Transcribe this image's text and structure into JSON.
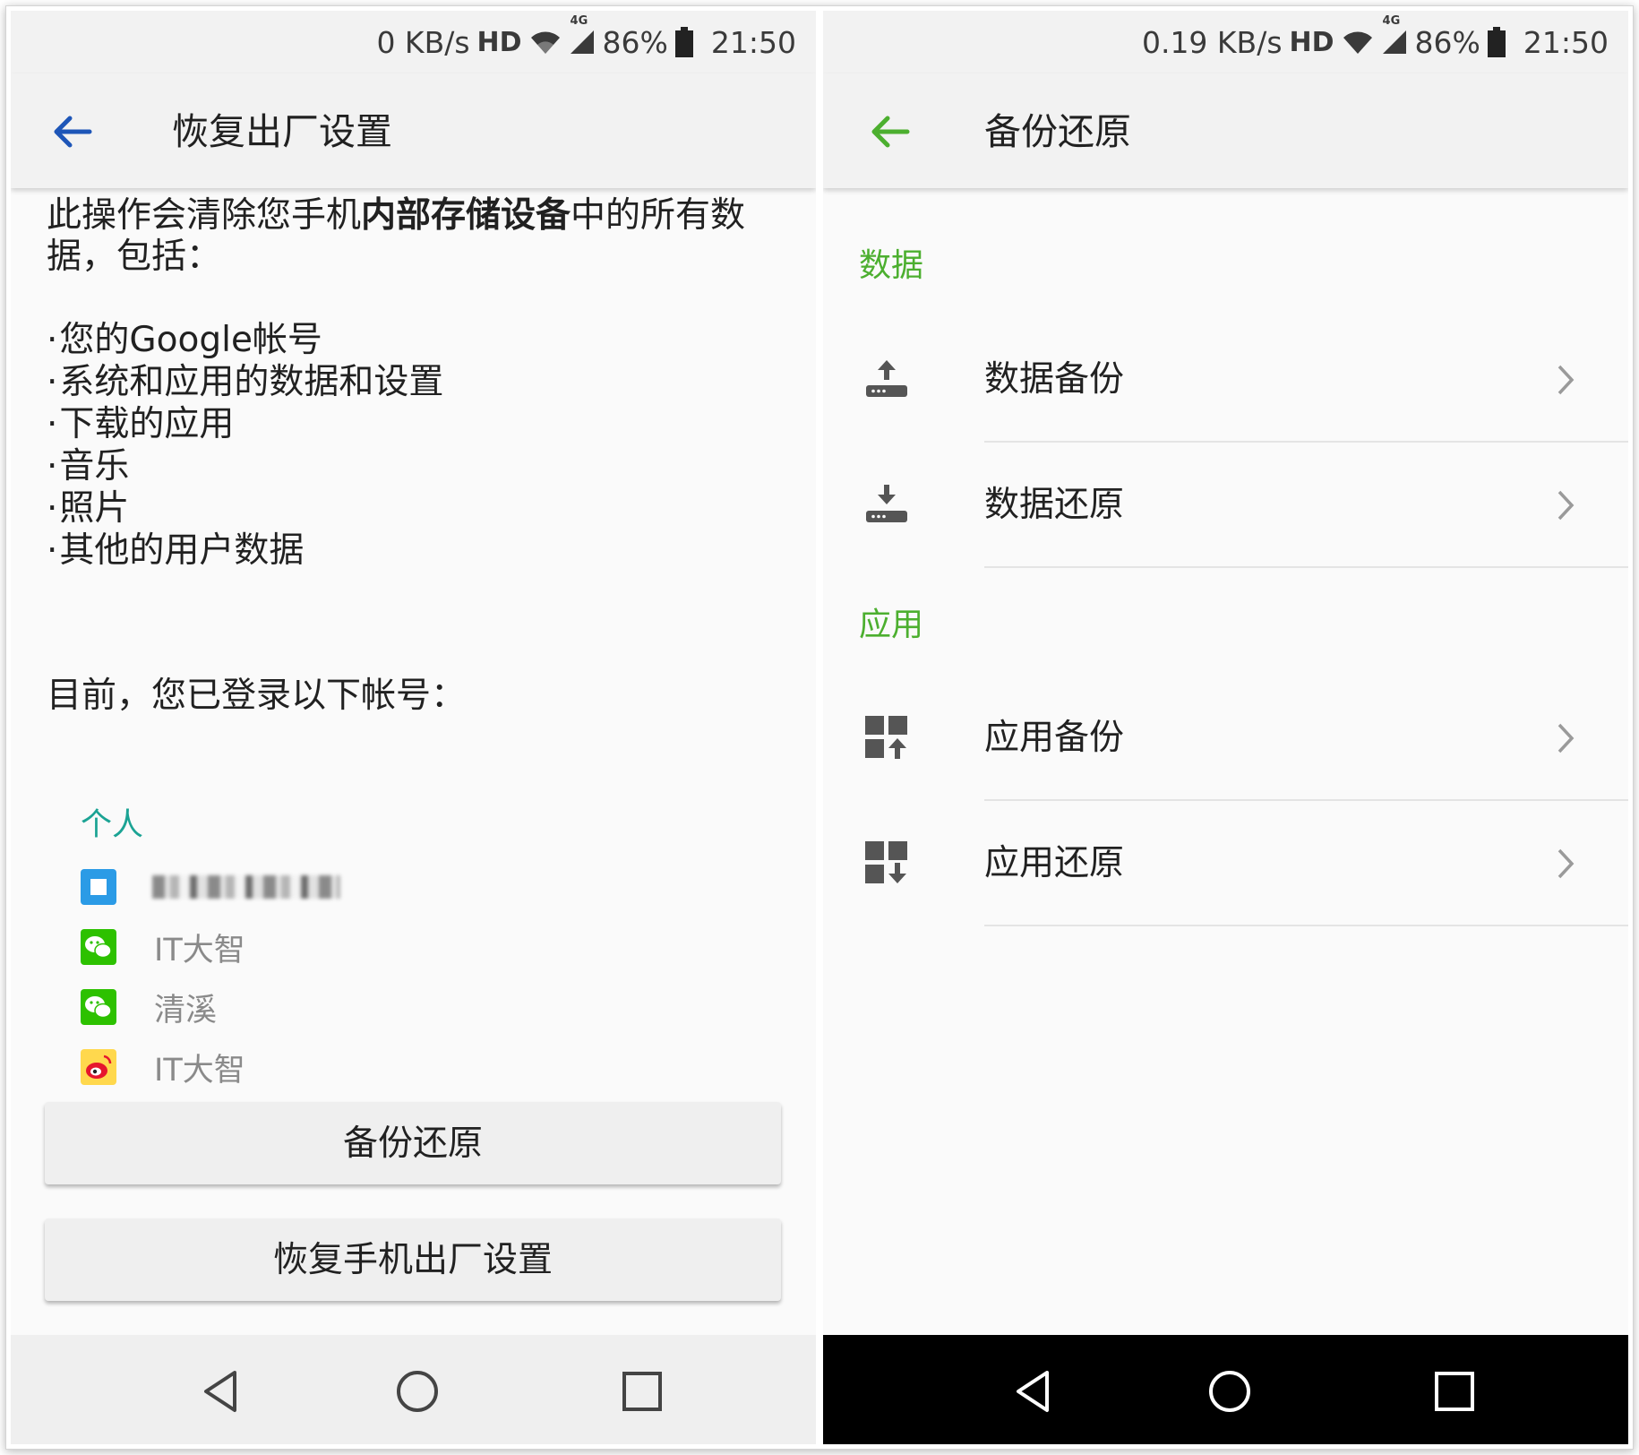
{
  "left": {
    "status": {
      "speed": "0 KB/s",
      "hd": "HD",
      "network": "4G",
      "battery": "86%",
      "time": "21:50"
    },
    "title": "恢复出厂设置",
    "intro_pre": "此操作会清除您手机",
    "intro_bold": "内部存储设备",
    "intro_post": "中的所有数据，包括：",
    "bullets": [
      "您的Google帐号",
      "系统和应用的数据和设置",
      "下载的应用",
      "音乐",
      "照片",
      "其他的用户数据"
    ],
    "logged_in": "目前，您已登录以下帐号：",
    "section_personal": "个人",
    "accounts": [
      {
        "icon": "square-app-icon",
        "name": ""
      },
      {
        "icon": "wechat-icon",
        "name": "IT大智"
      },
      {
        "icon": "wechat-icon",
        "name": "清溪"
      },
      {
        "icon": "weibo-icon",
        "name": "IT大智"
      }
    ],
    "buttons": {
      "backup_restore": "备份还原",
      "factory_reset": "恢复手机出厂设置"
    }
  },
  "right": {
    "status": {
      "speed": "0.19 KB/s",
      "hd": "HD",
      "network": "4G",
      "battery": "86%",
      "time": "21:50"
    },
    "title": "备份还原",
    "sections": [
      {
        "header": "数据",
        "items": [
          {
            "icon": "upload-icon",
            "label": "数据备份"
          },
          {
            "icon": "download-icon",
            "label": "数据还原"
          }
        ]
      },
      {
        "header": "应用",
        "items": [
          {
            "icon": "app-backup-icon",
            "label": "应用备份"
          },
          {
            "icon": "app-restore-icon",
            "label": "应用还原"
          }
        ]
      }
    ]
  },
  "colors": {
    "left_back": "#1e56b8",
    "right_accent": "#4caf2f",
    "personal_teal": "#1ba394"
  }
}
